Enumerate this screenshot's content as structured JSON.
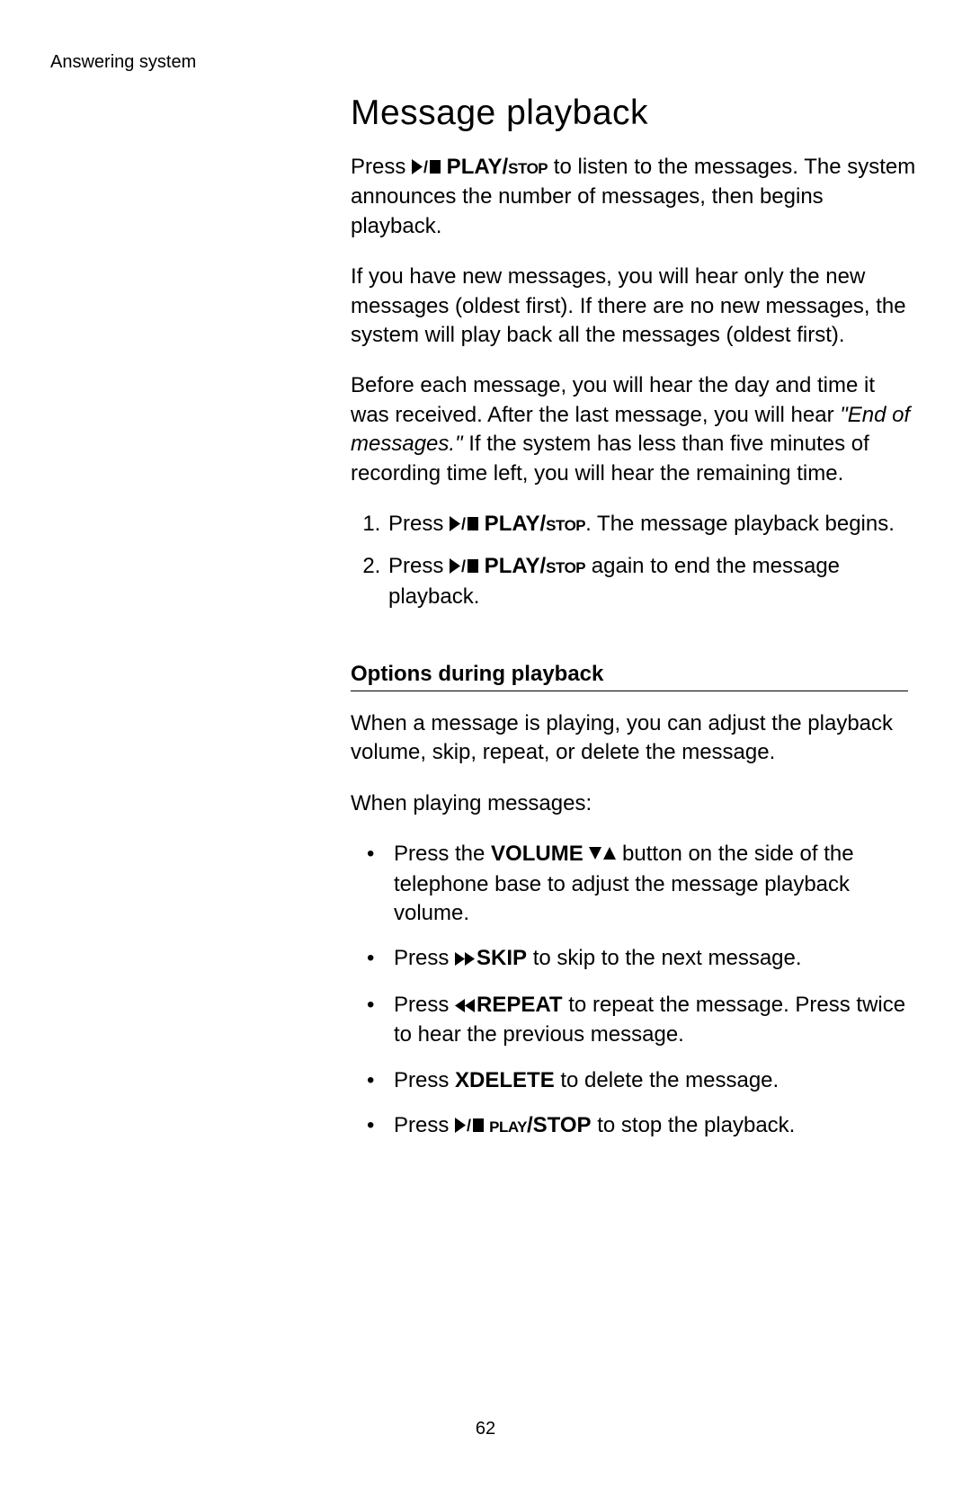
{
  "header": {
    "section": "Answering system"
  },
  "title": "Message playback",
  "intro": {
    "p1_a": "Press ",
    "p1_b": " PLAY/",
    "p1_c": "stop",
    "p1_d": " to listen to the messages. The system announces the number of messages, then begins playback.",
    "p2": "If you have new messages, you will hear only the new messages (oldest first). If there are no new messages, the system will play back all the messages (oldest first).",
    "p3_a": "Before each message, you will hear the day and time it was received. After the last message, you will hear ",
    "p3_b": "\"End of messages.\"",
    "p3_c": " If the system has less than five minutes of recording time left, you will hear the remaining time."
  },
  "steps": {
    "s1_a": "Press ",
    "s1_b": " PLAY/",
    "s1_c": "stop",
    "s1_d": ". The message playback begins.",
    "s2_a": "Press ",
    "s2_b": " PLAY/",
    "s2_c": "stop",
    "s2_d": " again to end the message playback."
  },
  "subheading": "Options during playback",
  "options_intro": {
    "p1": "When a message is playing, you can adjust the playback volume, skip, repeat, or delete the message.",
    "p2": "When playing messages:"
  },
  "bullets": {
    "b1_a": "Press the ",
    "b1_b": "VOLUME ",
    "b1_c": " button on the side of the telephone base to adjust the message playback volume.",
    "b2_a": "Press ",
    "b2_b": "SKIP",
    "b2_c": " to skip to the next message.",
    "b3_a": "Press ",
    "b3_b": "REPEAT",
    "b3_c": " to repeat the message. Press twice to hear the previous message.",
    "b4_a": "Press ",
    "b4_b": "XDELETE",
    "b4_c": " to delete the message.",
    "b5_a": "Press ",
    "b5_b": " play",
    "b5_c": "/STOP",
    "b5_d": " to stop the playback."
  },
  "pagenum": "62"
}
